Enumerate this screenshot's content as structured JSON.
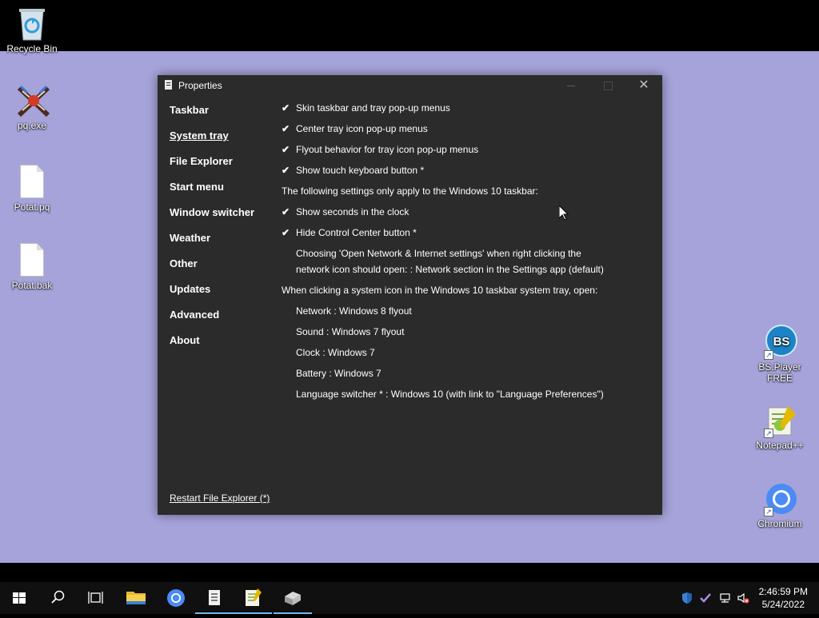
{
  "desktop": {
    "icons_left": [
      {
        "label": "Recycle Bin"
      },
      {
        "label": "pq.exe"
      },
      {
        "label": "Potat.pq"
      },
      {
        "label": "Potat.bak"
      }
    ],
    "icons_right": [
      {
        "label": "BS.Player FREE"
      },
      {
        "label": "Notepad++"
      },
      {
        "label": "Chromium"
      }
    ]
  },
  "window": {
    "title": "Properties",
    "nav": [
      {
        "label": "Taskbar"
      },
      {
        "label": "System tray"
      },
      {
        "label": "File Explorer"
      },
      {
        "label": "Start menu"
      },
      {
        "label": "Window switcher"
      },
      {
        "label": "Weather"
      },
      {
        "label": "Other"
      },
      {
        "label": "Updates"
      },
      {
        "label": "Advanced"
      },
      {
        "label": "About"
      }
    ],
    "active_nav": "System tray",
    "restart_link": "Restart File Explorer (*)",
    "settings": {
      "skin_taskbar": "Skin taskbar and tray pop-up menus",
      "center_tray": "Center tray icon pop-up menus",
      "flyout_behavior": "Flyout behavior for tray icon pop-up menus",
      "touch_keyboard": "Show touch keyboard button *",
      "win10_header": "The following settings only apply to the Windows 10 taskbar:",
      "show_seconds": "Show seconds in the clock",
      "hide_control_center": "Hide Control Center button *",
      "network_choice_line1": "Choosing 'Open Network & Internet settings' when right clicking the",
      "network_choice_line2": "network icon should open: : Network section in the Settings app (default)",
      "tray_header": "When clicking a system icon in the Windows 10 taskbar system tray, open:",
      "network": "Network : Windows 8 flyout",
      "sound": "Sound : Windows 7 flyout",
      "clock": "Clock : Windows 7",
      "battery": "Battery : Windows 7",
      "language": "Language switcher * : Windows 10 (with link to \"Language Preferences\")"
    },
    "check_mark": "✔"
  },
  "taskbar": {
    "time": "2:46:59 PM",
    "date": "5/24/2022"
  },
  "colors": {
    "desktop": "#a5a3d9",
    "window_bg": "#2b2b2b",
    "taskbar_bg": "#101010",
    "accent": "#76b9ed"
  }
}
